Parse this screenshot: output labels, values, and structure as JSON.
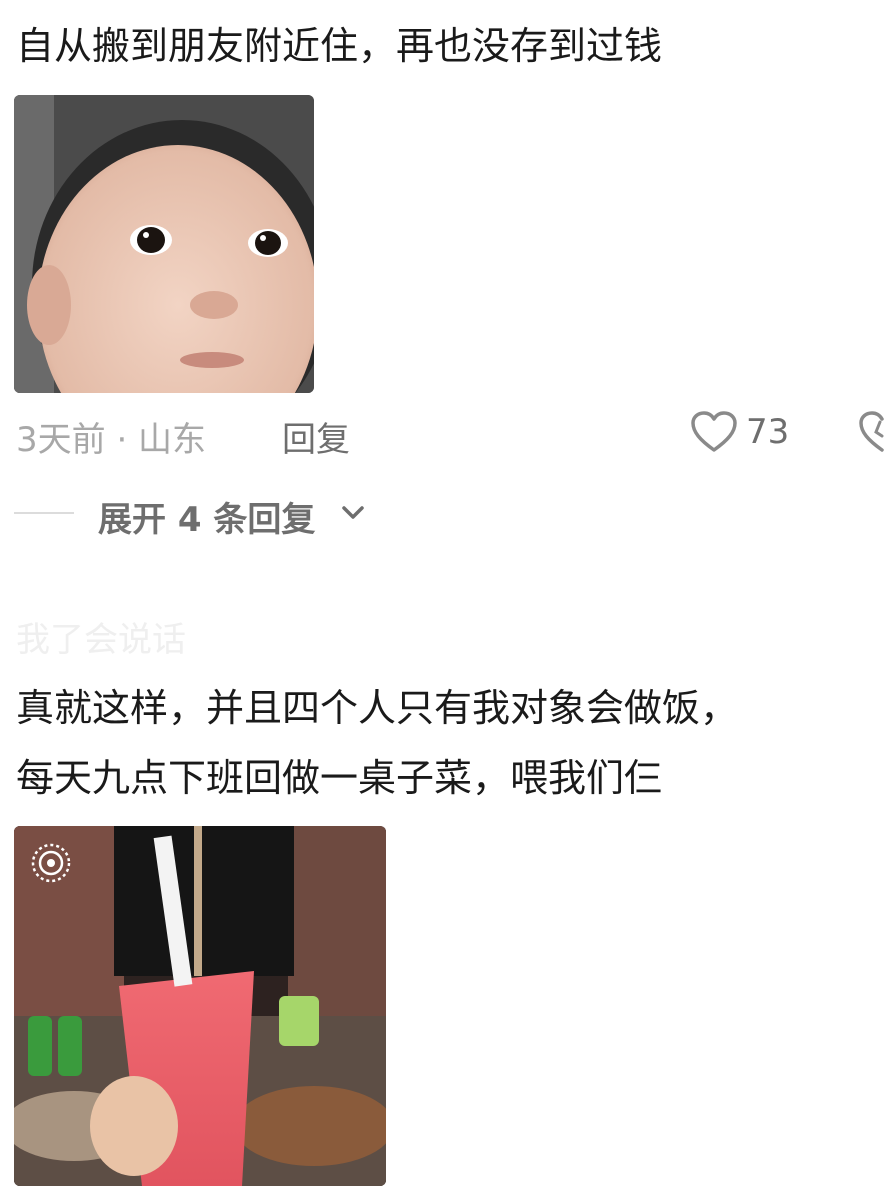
{
  "comment1": {
    "text": "自从搬到朋友附近住，再也没存到过钱",
    "time_location": "3天前 · 山东",
    "reply_label": "回复",
    "like_count": "73"
  },
  "expand": {
    "label": "展开 4 条回复"
  },
  "comment2": {
    "username": "我了会说话",
    "line1": "真就这样，并且四个人只有我对象会做饭，",
    "line2": "每天九点下班回做一桌子菜，喂我们仨"
  },
  "icons": {
    "like": "heart-outline-icon",
    "expand": "chevron-down-icon",
    "live_photo": "live-photo-icon"
  },
  "colors": {
    "text_primary": "#1a1a1a",
    "text_meta": "#a8a8a8",
    "text_action": "#6e6e6e",
    "background": "#ffffff"
  }
}
